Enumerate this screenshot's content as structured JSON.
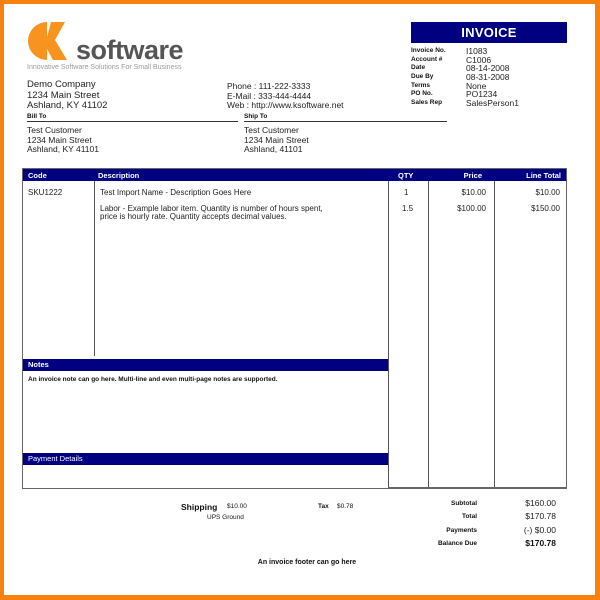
{
  "brand": {
    "name": "software",
    "tagline": "Innovative Software Solutions For Small Business",
    "accent_color": "#f7810f",
    "header_color": "#000080"
  },
  "company": {
    "name": "Demo Company",
    "street": "1234 Main Street",
    "city": "Ashland, KY 41102"
  },
  "contact": {
    "phone": "Phone : 111-222-3333",
    "email": "E-Mail : 333-444-4444",
    "web": "Web : http://www.ksoftware.net"
  },
  "invoice": {
    "title": "INVOICE",
    "meta": [
      {
        "label": "Invoice No.",
        "value": "I1083"
      },
      {
        "label": "Account #",
        "value": "C1006"
      },
      {
        "label": "Date",
        "value": "08-14-2008"
      },
      {
        "label": "Due By",
        "value": "08-31-2008"
      },
      {
        "label": "Terms",
        "value": "None"
      },
      {
        "label": "PO No.",
        "value": "PO1234"
      },
      {
        "label": "Sales Rep",
        "value": "SalesPerson1"
      }
    ]
  },
  "bill_to": {
    "heading": "Bill To",
    "name": "Test Customer",
    "street": "1234 Main Street",
    "city": "Ashland, KY 41101"
  },
  "ship_to": {
    "heading": "Ship To",
    "name": "Test Customer",
    "street": "1234 Main Street",
    "city": "Ashland,  41101"
  },
  "items": {
    "columns": [
      "Code",
      "Description",
      "QTY",
      "Price",
      "Line Total"
    ],
    "rows": [
      {
        "code": "SKU1222",
        "description": "Test Import Name - Description Goes Here",
        "description_line2": "",
        "qty": "1",
        "price": "$10.00",
        "total": "$10.00"
      },
      {
        "code": "",
        "description": "Labor - Example labor item. Quantity is number of hours spent,",
        "description_line2": "price is hourly rate. Quantity accepts decimal values.",
        "qty": "1.5",
        "price": "$100.00",
        "total": "$150.00"
      }
    ]
  },
  "notes": {
    "heading": "Notes",
    "text": "An invoice note can go here. Multi-line and even multi-page notes are supported."
  },
  "payment": {
    "heading": "Payment Details"
  },
  "shipping": {
    "label": "Shipping",
    "value": "$10.00",
    "method": "UPS Ground"
  },
  "tax": {
    "label": "Tax",
    "value": "$0.78"
  },
  "totals": [
    {
      "label": "Subtotal",
      "value": "$160.00",
      "bold": false
    },
    {
      "label": "Total",
      "value": "$170.78",
      "bold": false
    },
    {
      "label": "Payments",
      "value": "(-) $0.00",
      "bold": false
    },
    {
      "label": "Balance Due",
      "value": "$170.78",
      "bold": true
    }
  ],
  "footer": "An invoice footer can go here"
}
